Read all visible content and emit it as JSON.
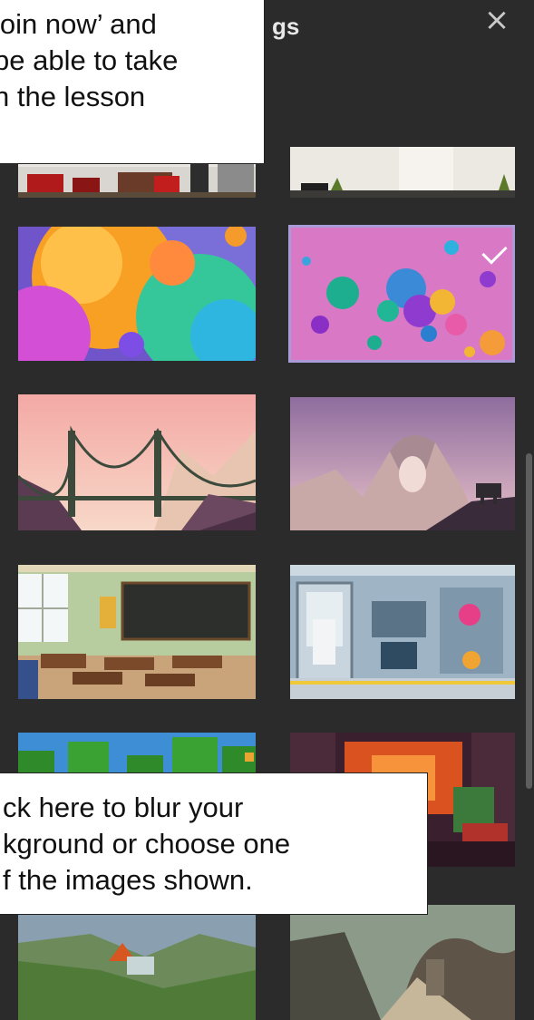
{
  "panel": {
    "title": "gs",
    "close_icon": "close-icon"
  },
  "callout_top": {
    "lines": [
      "join now’ and",
      "be able to take",
      "n the lesson"
    ]
  },
  "callout_bottom": {
    "lines": [
      "ck here to  blur your",
      "kground or choose one",
      "f the images shown."
    ]
  },
  "backgrounds": [
    {
      "name": "office-interior",
      "selected": false
    },
    {
      "name": "minimal-room",
      "selected": false
    },
    {
      "name": "colorful-bubbles-large",
      "selected": false
    },
    {
      "name": "pink-bubbles",
      "selected": true
    },
    {
      "name": "suspension-bridge",
      "selected": false
    },
    {
      "name": "rock-arch-rover",
      "selected": false
    },
    {
      "name": "classroom",
      "selected": false
    },
    {
      "name": "space-station-lab",
      "selected": false
    },
    {
      "name": "blocky-forest",
      "selected": false
    },
    {
      "name": "blocky-cave",
      "selected": false
    },
    {
      "name": "valley-landscape",
      "selected": false
    },
    {
      "name": "ruins-path",
      "selected": false
    }
  ],
  "colors": {
    "panel_bg": "#2b2b2b",
    "selection": "#a99ad8"
  }
}
